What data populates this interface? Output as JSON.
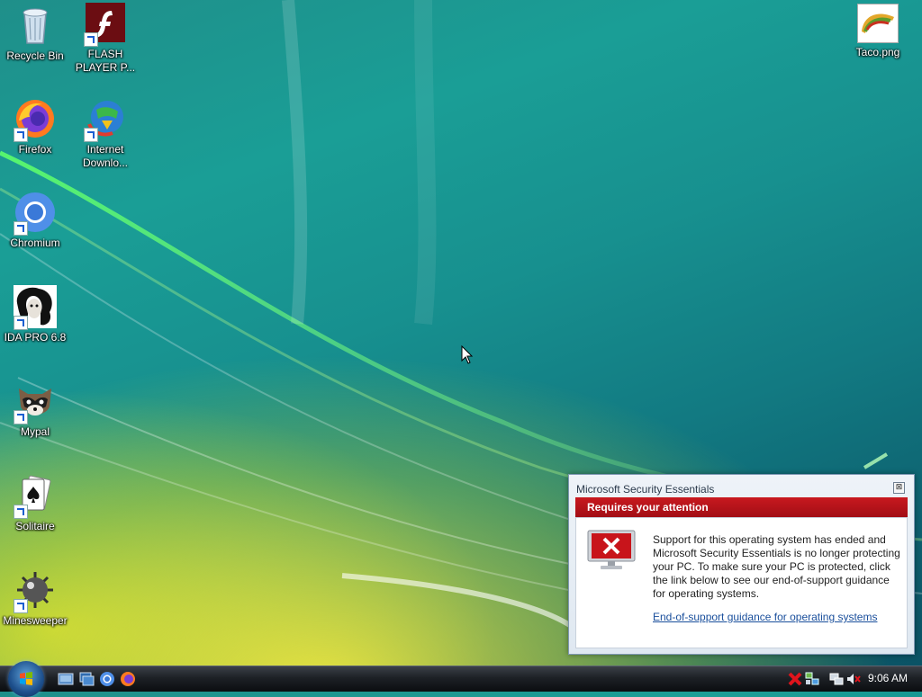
{
  "desktop": {
    "icons": [
      {
        "label": "Recycle Bin",
        "icon": "recycle-bin-icon"
      },
      {
        "label": "FLASH PLAYER P...",
        "icon": "flash-player-icon"
      },
      {
        "label": "Firefox",
        "icon": "firefox-icon"
      },
      {
        "label": "Internet Downlo...",
        "icon": "internet-download-manager-icon"
      },
      {
        "label": "Chromium",
        "icon": "chromium-icon"
      },
      {
        "label": "IDA PRO 6.8",
        "icon": "ida-pro-icon"
      },
      {
        "label": "Mypal",
        "icon": "mypal-icon"
      },
      {
        "label": "Solitaire",
        "icon": "solitaire-icon"
      },
      {
        "label": "Minesweeper",
        "icon": "minesweeper-icon"
      },
      {
        "label": "Taco.png",
        "icon": "taco-image-icon"
      }
    ]
  },
  "notification": {
    "title": "Microsoft Security Essentials",
    "header": "Requires your attention",
    "message": "Support for this operating system has ended and Microsoft Security Essentials is no longer protecting your PC. To make sure your PC is protected, click the link below to see our end-of-support guidance for operating systems.",
    "link": "End-of-support guidance for operating systems",
    "close_symbol": "⊠"
  },
  "taskbar": {
    "clock": "9:06 AM",
    "quick_launch": [
      "show-desktop-icon",
      "switch-windows-icon",
      "chromium-icon",
      "firefox-icon"
    ],
    "tray": [
      "security-alert-icon",
      "network-icon",
      "volume-muted-icon"
    ]
  },
  "colors": {
    "alert_red": "#b4141a",
    "link_blue": "#1a4f9c",
    "taskbar": "#1d2126"
  }
}
